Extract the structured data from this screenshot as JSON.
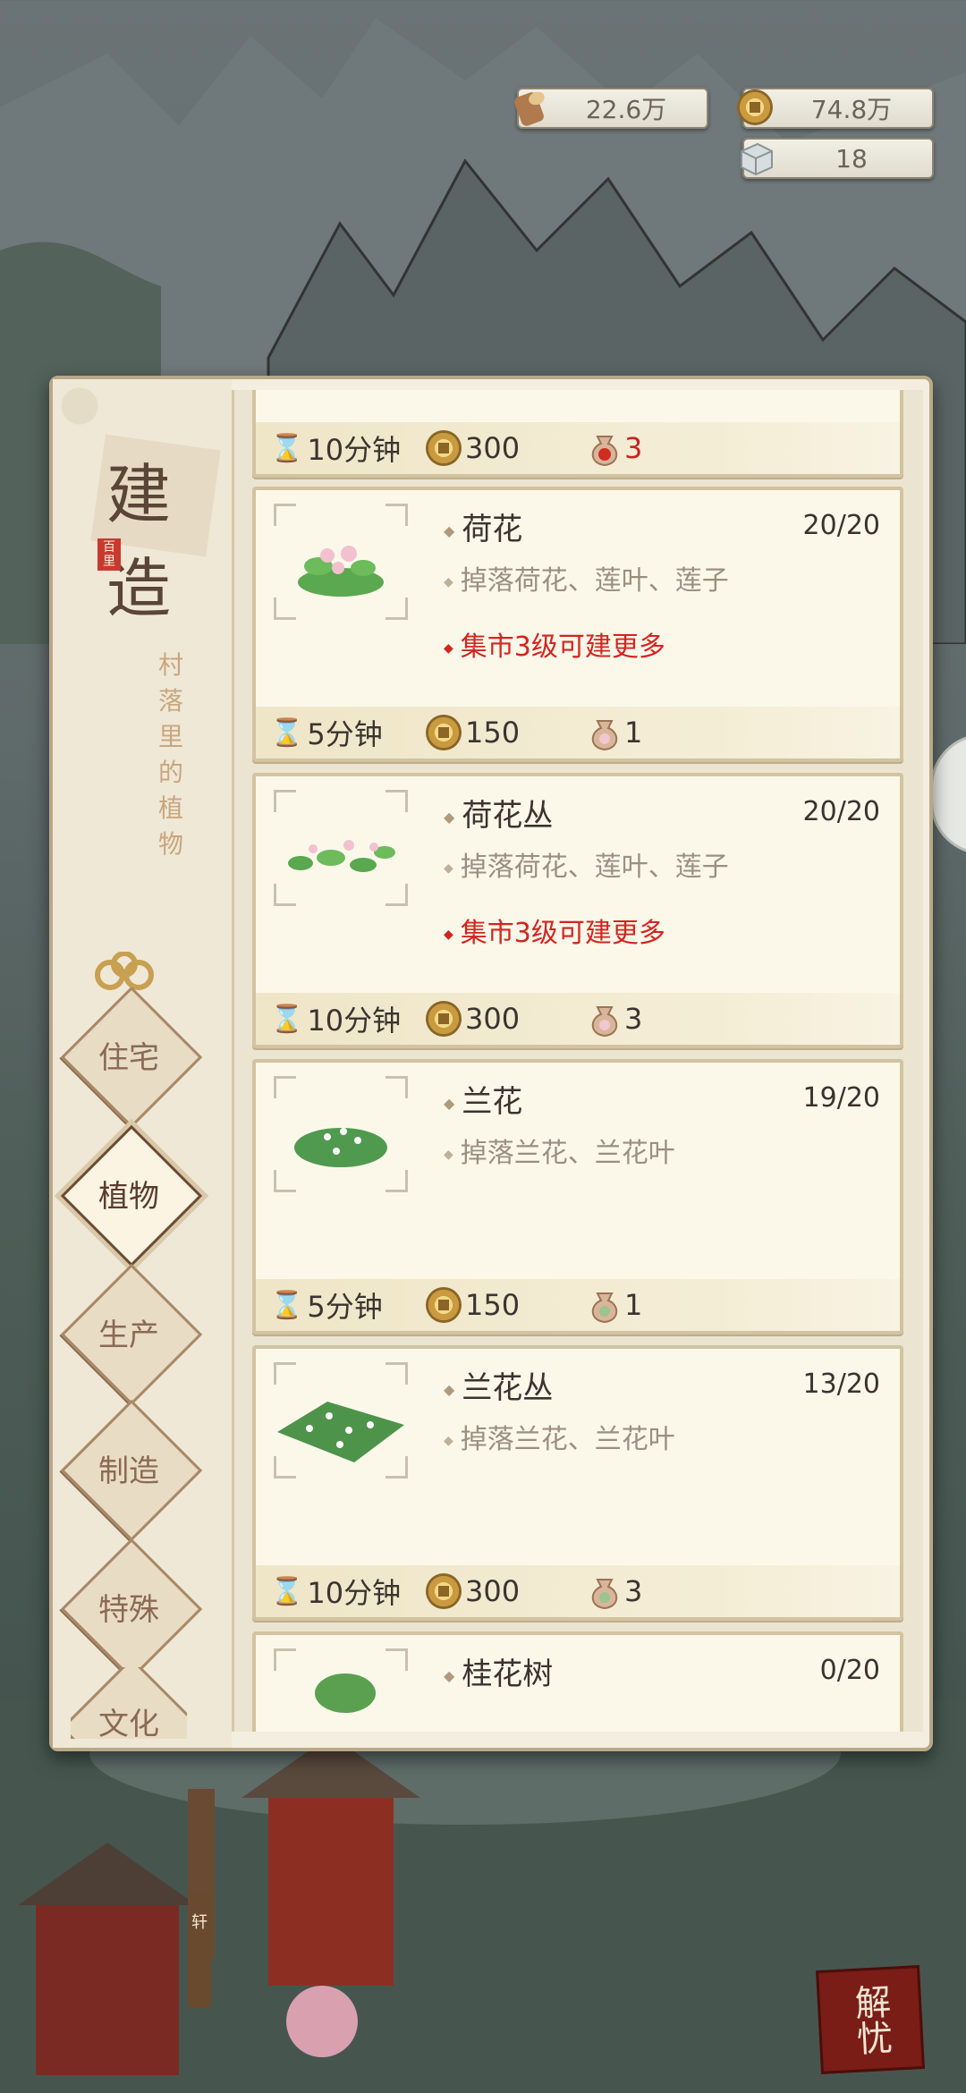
{
  "resources": [
    {
      "icon": "wood-icon",
      "value": "22.6万"
    },
    {
      "icon": "copper-coin-icon",
      "value": "74.8万"
    },
    {
      "icon": "stone-icon",
      "value": "18"
    }
  ],
  "panel": {
    "title": "建造",
    "stamp": "百里",
    "subtitle_chars": [
      "村",
      "落",
      "里",
      "的",
      "植",
      "物"
    ]
  },
  "tabs": [
    {
      "label": "住宅",
      "active": false
    },
    {
      "label": "植物",
      "active": true
    },
    {
      "label": "生产",
      "active": false
    },
    {
      "label": "制造",
      "active": false
    },
    {
      "label": "特殊",
      "active": false
    },
    {
      "label": "文化",
      "active": false
    }
  ],
  "cards": [
    {
      "name": "",
      "count": "",
      "drop": "",
      "note": "",
      "time": "10分钟",
      "coins": "300",
      "material": "3",
      "material_red": true,
      "partial": true
    },
    {
      "name": "荷花",
      "count": "20/20",
      "drop": "掉落荷花、莲叶、莲子",
      "note": "集市3级可建更多",
      "time": "5分钟",
      "coins": "150",
      "material": "1"
    },
    {
      "name": "荷花丛",
      "count": "20/20",
      "drop": "掉落荷花、莲叶、莲子",
      "note": "集市3级可建更多",
      "time": "10分钟",
      "coins": "300",
      "material": "3"
    },
    {
      "name": "兰花",
      "count": "19/20",
      "drop": "掉落兰花、兰花叶",
      "note": "",
      "time": "5分钟",
      "coins": "150",
      "material": "1"
    },
    {
      "name": "兰花丛",
      "count": "13/20",
      "drop": "掉落兰花、兰花叶",
      "note": "",
      "time": "10分钟",
      "coins": "300",
      "material": "3"
    },
    {
      "name": "桂花树",
      "count": "0/20",
      "drop": "",
      "note": "",
      "time": "",
      "coins": "",
      "material": ""
    }
  ],
  "bottom_button": "解忧",
  "map_sign": "轩"
}
